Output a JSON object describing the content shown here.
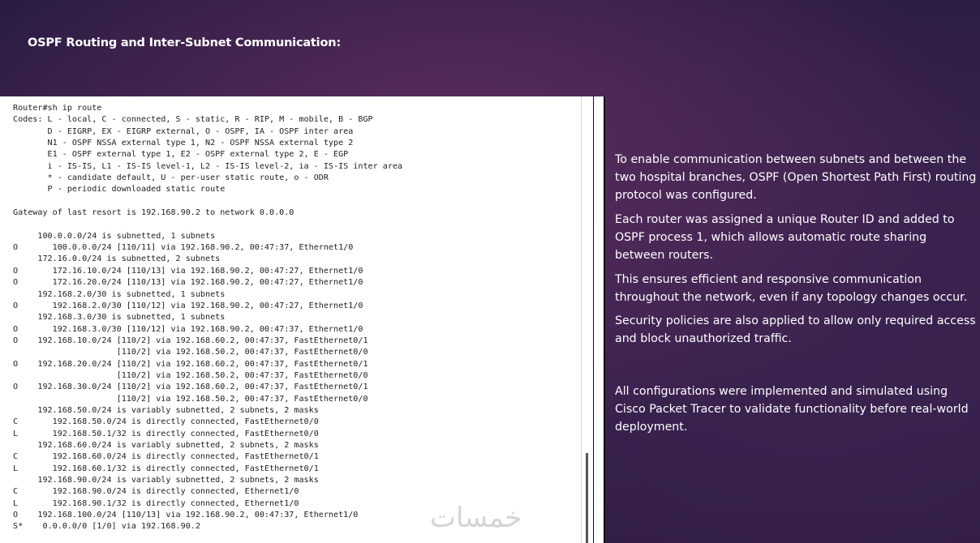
{
  "slide": {
    "title": "OSPF Routing and Inter-Subnet Communication:"
  },
  "terminal": {
    "output": "Router#sh ip route\nCodes: L - local, C - connected, S - static, R - RIP, M - mobile, B - BGP\n       D - EIGRP, EX - EIGRP external, O - OSPF, IA - OSPF inter area\n       N1 - OSPF NSSA external type 1, N2 - OSPF NSSA external type 2\n       E1 - OSPF external type 1, E2 - OSPF external type 2, E - EGP\n       i - IS-IS, L1 - IS-IS level-1, L2 - IS-IS level-2, ia - IS-IS inter area\n       * - candidate default, U - per-user static route, o - ODR\n       P - periodic downloaded static route\n\nGateway of last resort is 192.168.90.2 to network 0.0.0.0\n\n     100.0.0.0/24 is subnetted, 1 subnets\nO       100.0.0.0/24 [110/11] via 192.168.90.2, 00:47:37, Ethernet1/0\n     172.16.0.0/24 is subnetted, 2 subnets\nO       172.16.10.0/24 [110/13] via 192.168.90.2, 00:47:27, Ethernet1/0\nO       172.16.20.0/24 [110/13] via 192.168.90.2, 00:47:27, Ethernet1/0\n     192.168.2.0/30 is subnetted, 1 subnets\nO       192.168.2.0/30 [110/12] via 192.168.90.2, 00:47:27, Ethernet1/0\n     192.168.3.0/30 is subnetted, 1 subnets\nO       192.168.3.0/30 [110/12] via 192.168.90.2, 00:47:37, Ethernet1/0\nO    192.168.10.0/24 [110/2] via 192.168.60.2, 00:47:37, FastEthernet0/1\n                     [110/2] via 192.168.50.2, 00:47:37, FastEthernet0/0\nO    192.168.20.0/24 [110/2] via 192.168.60.2, 00:47:37, FastEthernet0/1\n                     [110/2] via 192.168.50.2, 00:47:37, FastEthernet0/0\nO    192.168.30.0/24 [110/2] via 192.168.60.2, 00:47:37, FastEthernet0/1\n                     [110/2] via 192.168.50.2, 00:47:37, FastEthernet0/0\n     192.168.50.0/24 is variably subnetted, 2 subnets, 2 masks\nC       192.168.50.0/24 is directly connected, FastEthernet0/0\nL       192.168.50.1/32 is directly connected, FastEthernet0/0\n     192.168.60.0/24 is variably subnetted, 2 subnets, 2 masks\nC       192.168.60.0/24 is directly connected, FastEthernet0/1\nL       192.168.60.1/32 is directly connected, FastEthernet0/1\n     192.168.90.0/24 is variably subnetted, 2 subnets, 2 masks\nC       192.168.90.0/24 is directly connected, Ethernet1/0\nL       192.168.90.1/32 is directly connected, Ethernet1/0\nO    192.168.100.0/24 [110/13] via 192.168.90.2, 00:47:37, Ethernet1/0\nS*    0.0.0.0/0 [1/0] via 192.168.90.2",
    "watermark": "خمسات"
  },
  "description": {
    "paragraphs": [
      "To enable communication between subnets and between the two hospital branches, OSPF (Open Shortest Path First) routing protocol was configured.",
      "Each router was assigned a unique Router ID and added to OSPF process 1, which allows automatic route sharing between routers.",
      "This ensures efficient and responsive communication throughout the network, even if any topology changes occur.",
      "Security policies are also applied to allow only required access and block unauthorized traffic.",
      "All configurations were implemented and simulated using Cisco Packet Tracer to validate functionality before real-world deployment."
    ]
  }
}
